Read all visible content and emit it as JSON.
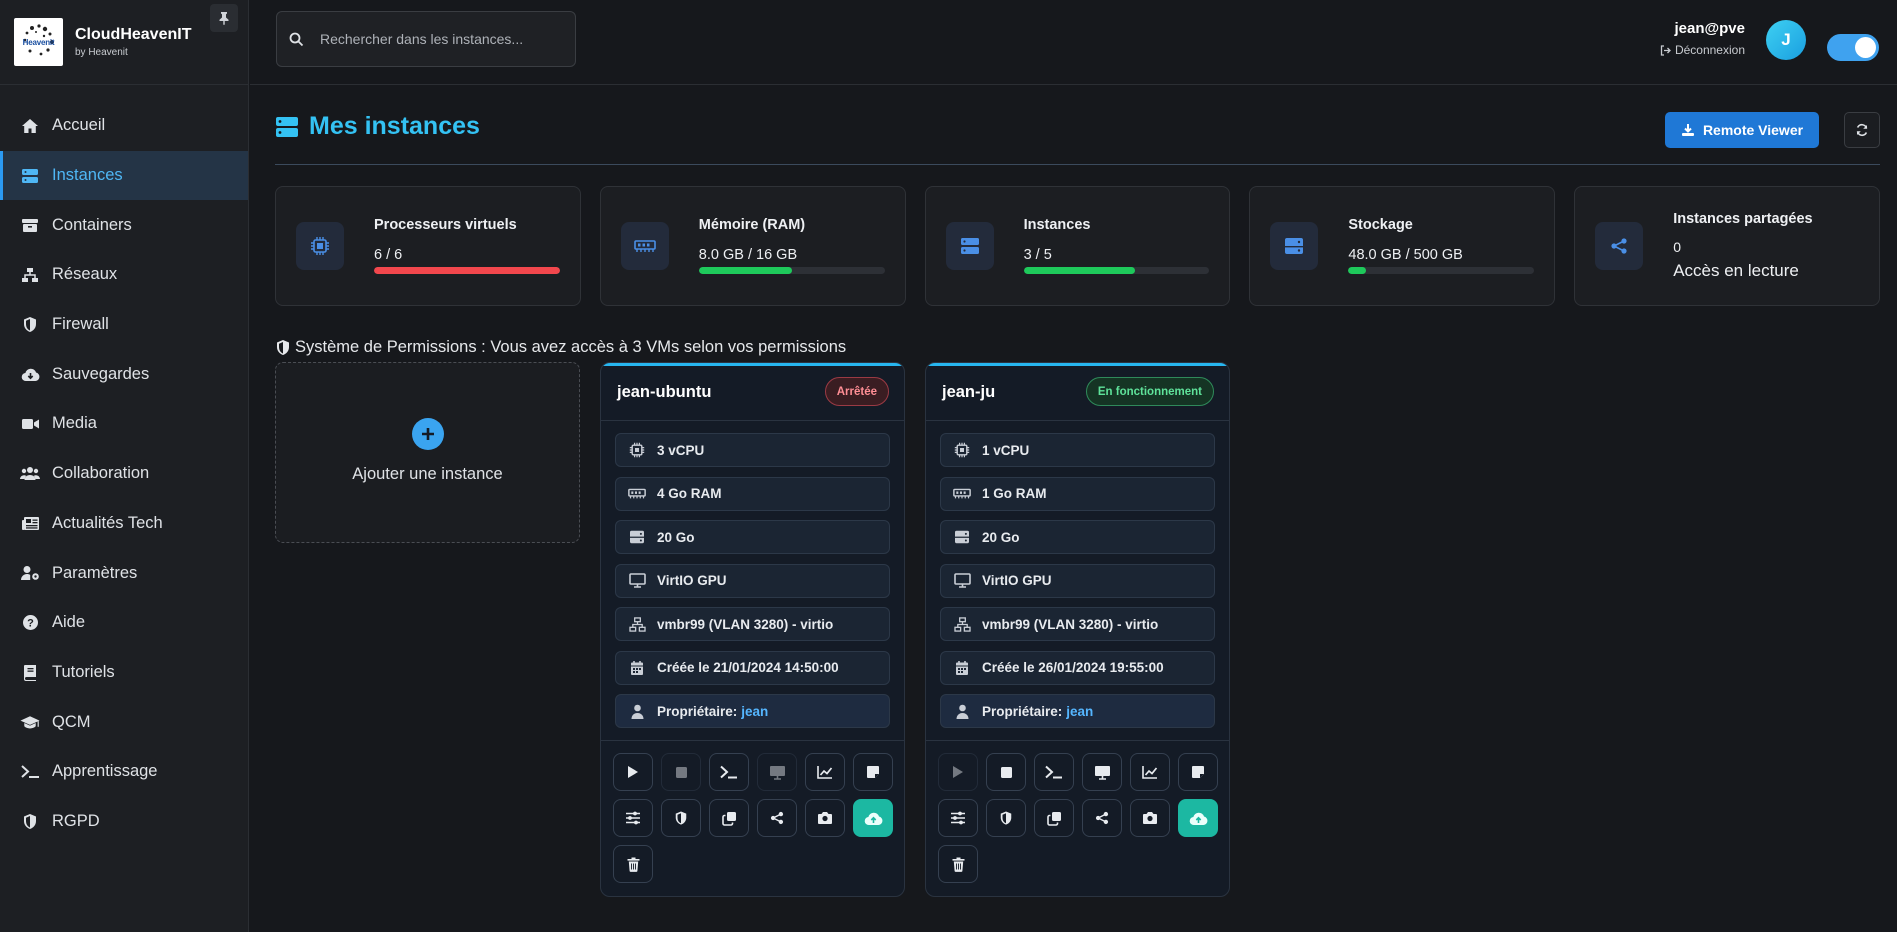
{
  "brand": {
    "name": "CloudHeavenIT",
    "sub": "by Heavenit",
    "logo_word": "Heavenit"
  },
  "search": {
    "placeholder": "Rechercher dans les instances..."
  },
  "user": {
    "name": "jean@pve",
    "logout": "Déconnexion",
    "avatar_letter": "J",
    "theme_toggle_on": true
  },
  "sidebar": {
    "items": [
      {
        "label": "Accueil",
        "icon": "home-icon"
      },
      {
        "label": "Instances",
        "icon": "server-icon",
        "active": true
      },
      {
        "label": "Containers",
        "icon": "box-icon"
      },
      {
        "label": "Réseaux",
        "icon": "network-icon"
      },
      {
        "label": "Firewall",
        "icon": "shield-icon"
      },
      {
        "label": "Sauvegardes",
        "icon": "cloud-download-icon"
      },
      {
        "label": "Media",
        "icon": "video-icon"
      },
      {
        "label": "Collaboration",
        "icon": "users-icon"
      },
      {
        "label": "Actualités Tech",
        "icon": "newspaper-icon"
      },
      {
        "label": "Paramètres",
        "icon": "user-gear-icon"
      },
      {
        "label": "Aide",
        "icon": "question-icon"
      },
      {
        "label": "Tutoriels",
        "icon": "book-icon"
      },
      {
        "label": "QCM",
        "icon": "graduation-cap-icon"
      },
      {
        "label": "Apprentissage",
        "icon": "terminal-icon"
      },
      {
        "label": "RGPD",
        "icon": "shield-icon"
      }
    ]
  },
  "page": {
    "title": "Mes instances",
    "remote_viewer": "Remote Viewer"
  },
  "stats": {
    "cpu": {
      "label": "Processeurs virtuels",
      "value": "6 / 6",
      "fill": 1.0,
      "color": "#f2474d"
    },
    "ram": {
      "label": "Mémoire (RAM)",
      "value": "8.0 GB / 16 GB",
      "fill": 0.5,
      "color": "#1ec95b"
    },
    "instances": {
      "label": "Instances",
      "value": "3 / 5",
      "fill": 0.6,
      "color": "#1ec95b"
    },
    "storage": {
      "label": "Stockage",
      "value": "48.0 GB / 500 GB",
      "fill": 0.096,
      "color": "#1ec95b"
    },
    "shared": {
      "label": "Instances partagées",
      "value": "0",
      "sub": "Accès en lecture"
    }
  },
  "permissions_text": "Système de Permissions : Vous avez accès à 3 VMs selon vos permissions",
  "add_instance_label": "Ajouter une instance",
  "vms": [
    {
      "name": "jean-ubuntu",
      "status": "Arrêtée",
      "cpu": "3 vCPU",
      "ram": "4 Go RAM",
      "disk": "20 Go",
      "gpu": "VirtIO GPU",
      "network": "vmbr99 (VLAN 3280) - virtio",
      "created": "Créée le 21/01/2024 14:50:00",
      "owner_label": "Propriétaire:",
      "owner": "jean"
    },
    {
      "name": "jean-ju",
      "status": "En fonctionnement",
      "cpu": "1 vCPU",
      "ram": "1 Go RAM",
      "disk": "20 Go",
      "gpu": "VirtIO GPU",
      "network": "vmbr99 (VLAN 3280) - virtio",
      "created": "Créée le 26/01/2024 19:55:00",
      "owner_label": "Propriétaire:",
      "owner": "jean"
    }
  ]
}
